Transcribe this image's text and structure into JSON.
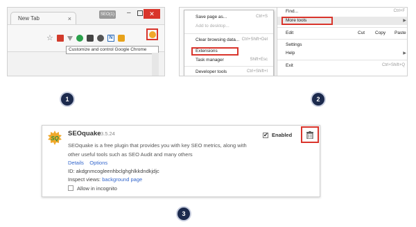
{
  "panel1": {
    "tab_title": "New Tab",
    "tab_close": "×",
    "user_label": "SEO(1)",
    "window_min": "–",
    "window_close": "✕",
    "tooltip": "Customize and control Google Chrome",
    "n_icon_letter": "N"
  },
  "panel2": {
    "submenu_items": [
      {
        "label": "Save page as...",
        "shortcut": "Ctrl+S"
      },
      {
        "label": "Add to desktop...",
        "shortcut": ""
      },
      {
        "label": "Clear browsing data...",
        "shortcut": "Ctrl+Shift+Del"
      },
      {
        "label": "Extensions",
        "shortcut": ""
      },
      {
        "label": "Task manager",
        "shortcut": "Shift+Esc"
      },
      {
        "label": "Developer tools",
        "shortcut": "Ctrl+Shift+I"
      }
    ],
    "main_menu": {
      "find": {
        "label": "Find...",
        "shortcut": "Ctrl+F"
      },
      "more_tools": {
        "label": "More tools",
        "arrow": "▶"
      },
      "edit": {
        "label": "Edit",
        "cut": "Cut",
        "copy": "Copy",
        "paste": "Paste"
      },
      "settings": {
        "label": "Settings"
      },
      "help": {
        "label": "Help",
        "arrow": "▶"
      },
      "exit": {
        "label": "Exit",
        "shortcut": "Ctrl+Shift+Q"
      }
    }
  },
  "panel3": {
    "name": "SEOquake",
    "version": "3.5.24",
    "description": "SEOquake is a free plugin that provides you with key SEO metrics, along with other useful tools such as SEO Audit and many others",
    "details_link": "Details",
    "options_link": "Options",
    "id_text": "ID: akdgnmcogleenhbclghghlkkdndkjdjc",
    "inspect_label": "Inspect views:",
    "inspect_link": "background page",
    "incognito_label": "Allow in incognito",
    "enabled_label": "Enabled",
    "enabled_check": "✔"
  },
  "badges": [
    "1",
    "2",
    "3"
  ],
  "colors": {
    "highlight": "#d9342b",
    "badge": "#1c2a4d",
    "link": "#3366cc"
  }
}
